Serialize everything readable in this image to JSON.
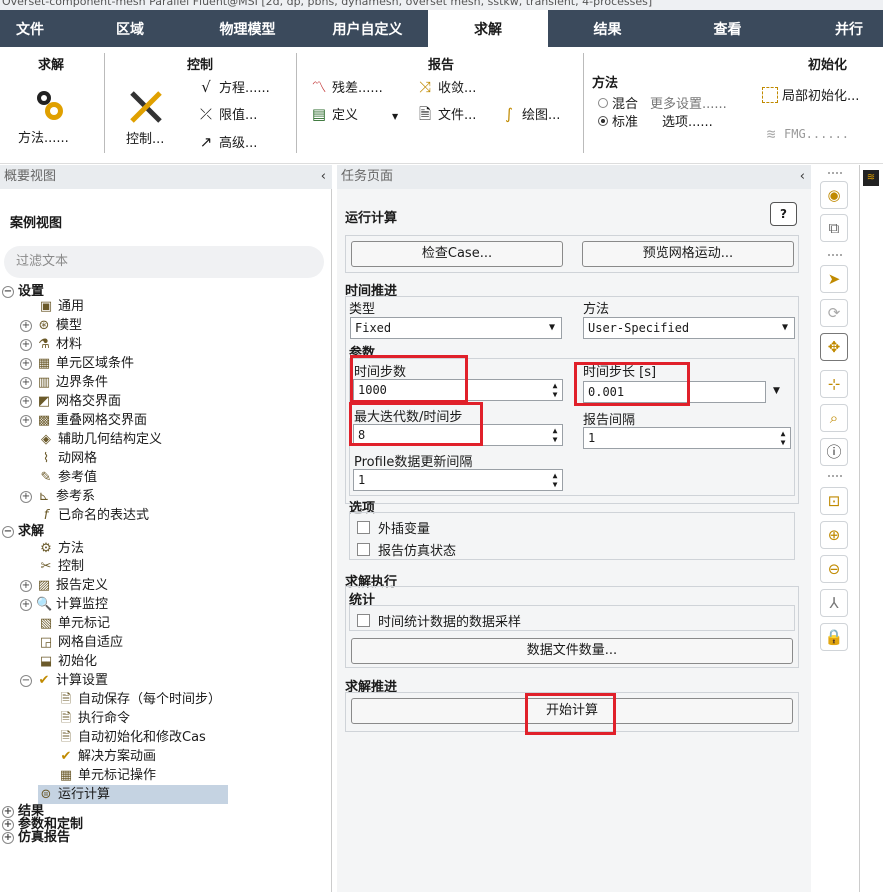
{
  "titlebar": {
    "text": "Overset-component-mesh Parallel Fluent@MSI  [2d, dp, pbns, dynamesh, overset mesh, sstkw, transient, 4-processes]"
  },
  "menu": [
    "文件",
    "区域",
    "物理模型",
    "用户自定义",
    "求解",
    "结果",
    "查看",
    "并行"
  ],
  "ribbon": {
    "solve_title": "求解",
    "methods_label": "方法......",
    "control_title": "控制",
    "controls_label": "控制...",
    "equations_label": "方程......",
    "limits_label": "限值...",
    "advanced_label": "高级...",
    "report_title": "报告",
    "residuals_label": "残差......",
    "convergence_label": "收敛...",
    "definitions_label": "定义",
    "files_label": "文件...",
    "plots_label": "绘图...",
    "init_title": "初始化",
    "method_label": "方法",
    "hybrid_label": "混合",
    "more_settings_label": "更多设置......",
    "standard_label": "标准",
    "options_label": "选项......",
    "patch_label": "局部初始化...",
    "fmg_label": "FMG......"
  },
  "outline": {
    "header": "概要视图",
    "case_view": "案例视图",
    "filter_placeholder": "过滤文本",
    "items": [
      {
        "label": "设置",
        "icon": "collapse-icon"
      },
      {
        "label": "通用",
        "icon": "general-icon"
      },
      {
        "label": "模型",
        "icon": "models-icon"
      },
      {
        "label": "材料",
        "icon": "materials-icon"
      },
      {
        "label": "单元区域条件",
        "icon": "cell-zone-icon"
      },
      {
        "label": "边界条件",
        "icon": "boundary-icon"
      },
      {
        "label": "网格交界面",
        "icon": "mesh-interface-icon"
      },
      {
        "label": "重叠网格交界面",
        "icon": "overset-icon"
      },
      {
        "label": "辅助几何结构定义",
        "icon": "geometry-icon"
      },
      {
        "label": "动网格",
        "icon": "dynamic-mesh-icon"
      },
      {
        "label": "参考值",
        "icon": "reference-values-icon"
      },
      {
        "label": "参考系",
        "icon": "reference-frame-icon"
      },
      {
        "label": "已命名的表达式",
        "icon": "expression-icon"
      },
      {
        "label": "求解",
        "icon": "collapse-icon"
      },
      {
        "label": "方法",
        "icon": "methods-icon"
      },
      {
        "label": "控制",
        "icon": "controls-icon"
      },
      {
        "label": "报告定义",
        "icon": "report-definitions-icon"
      },
      {
        "label": "计算监控",
        "icon": "monitors-icon"
      },
      {
        "label": "单元标记",
        "icon": "cell-register-icon"
      },
      {
        "label": "网格自适应",
        "icon": "adaption-icon"
      },
      {
        "label": "初始化",
        "icon": "initialization-icon"
      },
      {
        "label": "计算设置",
        "icon": "calc-activities-icon"
      },
      {
        "label": "自动保存（每个时间步）",
        "icon": "autosave-icon"
      },
      {
        "label": "执行命令",
        "icon": "execute-commands-icon"
      },
      {
        "label": "自动初始化和修改Cas",
        "icon": "auto-init-icon"
      },
      {
        "label": "解决方案动画",
        "icon": "animation-icon"
      },
      {
        "label": "单元标记操作",
        "icon": "cell-register-ops-icon"
      },
      {
        "label": "运行计算",
        "icon": "run-calculation-icon"
      },
      {
        "label": "结果",
        "icon": "expand-icon"
      },
      {
        "label": "参数和定制",
        "icon": "expand-icon"
      },
      {
        "label": "仿真报告",
        "icon": "expand-icon"
      }
    ]
  },
  "task": {
    "header": "任务页面",
    "title": "运行计算",
    "help": "?",
    "check_case": "检查Case...",
    "preview_mesh": "预览网格运动...",
    "time_advancement": "时间推进",
    "type_label": "类型",
    "type_value": "Fixed",
    "method_label": "方法",
    "method_value": "User-Specified",
    "parameters": "参数",
    "num_time_steps_label": "时间步数",
    "num_time_steps": "1000",
    "time_step_size_label": "时间步长 [s]",
    "time_step_size": "0.001",
    "max_iter_label": "最大迭代数/时间步",
    "max_iter": "8",
    "report_interval_label": "报告间隔",
    "report_interval": "1",
    "profile_interval_label": "Profile数据更新间隔",
    "profile_interval": "1",
    "options": "选项",
    "extrapolate": "外插变量",
    "report_status": "报告仿真状态",
    "solution_processing": "求解执行",
    "statistics": "统计",
    "sampling": "时间统计数据的数据采样",
    "data_file_quantities": "数据文件数量...",
    "solution_advancement": "求解推进",
    "calculate": "开始计算"
  }
}
